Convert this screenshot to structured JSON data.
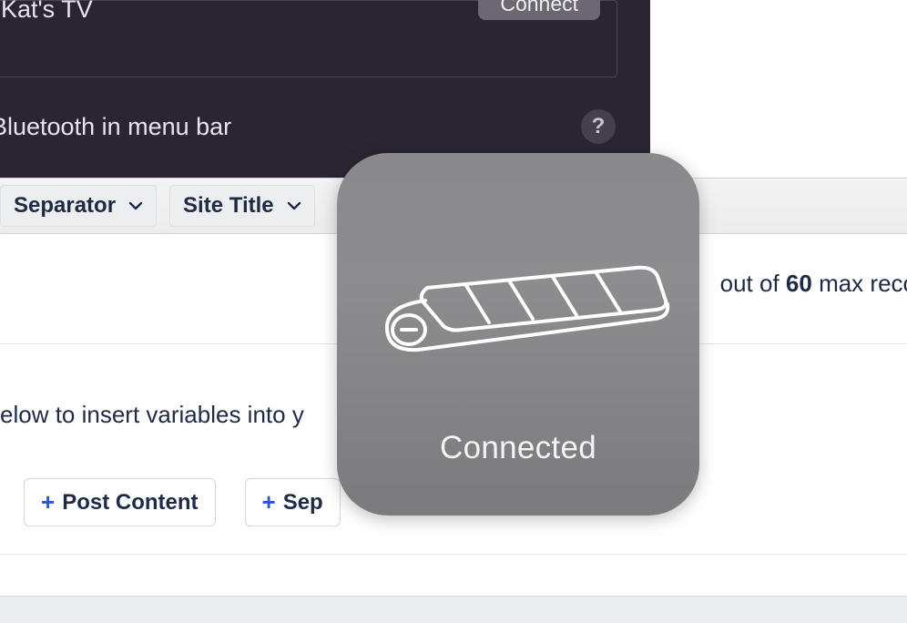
{
  "bluetooth_panel": {
    "device_name": "Kat's TV",
    "connect_label": "Connect",
    "menubar_label": " Bluetooth in menu bar",
    "help_label": "?"
  },
  "toolbar": {
    "separator_label": "Separator",
    "site_title_label": "Site Title"
  },
  "info": {
    "right_fragment_prefix": "out of ",
    "max_value": "60",
    "right_fragment_suffix": " max reco"
  },
  "instructions": {
    "fragment": "elow to insert variables into y"
  },
  "pills": {
    "post_content": "Post Content",
    "separator_fragment": "Sep"
  },
  "hud": {
    "status": "Connected",
    "icon_name": "keyboard-icon"
  }
}
